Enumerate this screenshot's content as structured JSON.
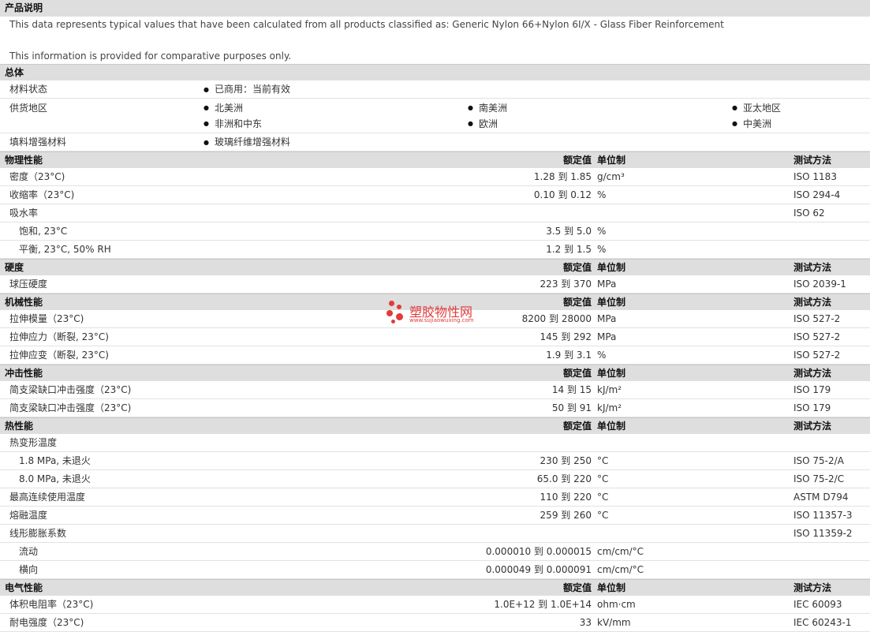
{
  "product_desc": {
    "header": "产品说明",
    "line1": "This data represents typical values that have been calculated from all products classified as: Generic Nylon 66+Nylon 6I/X - Glass Fiber Reinforcement",
    "line2": "This information is provided for comparative purposes only."
  },
  "general": {
    "header": "总体",
    "material_status_label": "材料状态",
    "material_status_value": "已商用：当前有效",
    "supply_label": "供货地区",
    "supply_regions": [
      "北美洲",
      "南美洲",
      "亚太地区",
      "非洲和中东",
      "欧洲",
      "中美洲"
    ],
    "filler_label": "填料增强材料",
    "filler_value": "玻璃纤维增强材料"
  },
  "columns": {
    "nominal": "额定值",
    "unit": "单位制",
    "method": "测试方法"
  },
  "sections": [
    {
      "title": "物理性能",
      "rows": [
        {
          "label": "密度（23°C)",
          "value": "1.28 到  1.85",
          "unit": "g/cm³",
          "method": "ISO 1183"
        },
        {
          "label": "收缩率（23°C)",
          "value": "0.10 到  0.12",
          "unit": "%",
          "method": "ISO 294-4"
        },
        {
          "label": "吸水率",
          "value": "",
          "unit": "",
          "method": "ISO 62"
        },
        {
          "label": "饱和, 23°C",
          "value": "3.5 到  5.0",
          "unit": "%",
          "method": "",
          "indent": true
        },
        {
          "label": "平衡, 23°C, 50% RH",
          "value": "1.2 到  1.5",
          "unit": "%",
          "method": "",
          "indent": true
        }
      ]
    },
    {
      "title": "硬度",
      "rows": [
        {
          "label": "球压硬度",
          "value": "223 到  370",
          "unit": "MPa",
          "method": "ISO 2039-1"
        }
      ]
    },
    {
      "title": "机械性能",
      "rows": [
        {
          "label": "拉伸模量（23°C)",
          "value": "8200 到  28000",
          "unit": "MPa",
          "method": "ISO 527-2"
        },
        {
          "label": "拉伸应力（断裂, 23°C)",
          "value": "145 到  292",
          "unit": "MPa",
          "method": "ISO 527-2"
        },
        {
          "label": "拉伸应变（断裂, 23°C)",
          "value": "1.9 到  3.1",
          "unit": "%",
          "method": "ISO 527-2"
        }
      ]
    },
    {
      "title": "冲击性能",
      "rows": [
        {
          "label": "简支梁缺口冲击强度（23°C)",
          "value": "14 到  15",
          "unit": "kJ/m²",
          "method": "ISO 179"
        },
        {
          "label": "简支梁缺口冲击强度（23°C)",
          "value": "50 到  91",
          "unit": "kJ/m²",
          "method": "ISO 179"
        }
      ]
    },
    {
      "title": "热性能",
      "rows": [
        {
          "label": "热变形温度",
          "value": "",
          "unit": "",
          "method": ""
        },
        {
          "label": "1.8 MPa, 未退火",
          "value": "230 到  250",
          "unit": "°C",
          "method": "ISO 75-2/A",
          "indent": true
        },
        {
          "label": "8.0 MPa, 未退火",
          "value": "65.0 到  220",
          "unit": "°C",
          "method": "ISO 75-2/C",
          "indent": true
        },
        {
          "label": "最高连续使用温度",
          "value": "110 到  220",
          "unit": "°C",
          "method": "ASTM D794"
        },
        {
          "label": "熔融温度",
          "value": "259 到  260",
          "unit": "°C",
          "method": "ISO 11357-3"
        },
        {
          "label": "线形膨胀系数",
          "value": "",
          "unit": "",
          "method": "ISO 11359-2"
        },
        {
          "label": "流动",
          "value": "0.000010 到  0.000015",
          "unit": "cm/cm/°C",
          "method": "",
          "indent": true
        },
        {
          "label": "横向",
          "value": "0.000049 到  0.000091",
          "unit": "cm/cm/°C",
          "method": "",
          "indent": true
        }
      ]
    },
    {
      "title": "电气性能",
      "rows": [
        {
          "label": "体积电阻率（23°C)",
          "value": "1.0E+12 到  1.0E+14",
          "unit": "ohm·cm",
          "method": "IEC 60093"
        },
        {
          "label": "耐电强度（23°C)",
          "value": "33",
          "unit": "kV/mm",
          "method": "IEC 60243-1"
        }
      ]
    }
  ],
  "watermark": {
    "name": "塑胶物性网",
    "url": "www.sujiaowuxing.com"
  }
}
